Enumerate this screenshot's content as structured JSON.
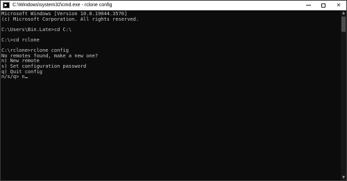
{
  "window": {
    "title": "C:\\Windows\\system32\\cmd.exe - rclone  config",
    "icon": "cmd-icon"
  },
  "controls": {
    "minimize": "minimize-icon",
    "maximize": "maximize-icon",
    "close": "close-icon"
  },
  "console": {
    "lines": [
      "Microsoft Windows [Version 10.0.19044.3570]",
      "(c) Microsoft Corporation. All rights reserved.",
      "",
      "C:\\Users\\Bin.Late>cd C:\\",
      "",
      "C:\\>cd rclone",
      "",
      "C:\\rclone>rclone config",
      "No remotes found, make a new one?",
      "n) New remote",
      "s) Set configuration password",
      "q) Quit config",
      "n/s/q> n"
    ]
  },
  "colors": {
    "background": "#0c0c0c",
    "text": "#cccccc",
    "titlebar": "#ffffff"
  }
}
